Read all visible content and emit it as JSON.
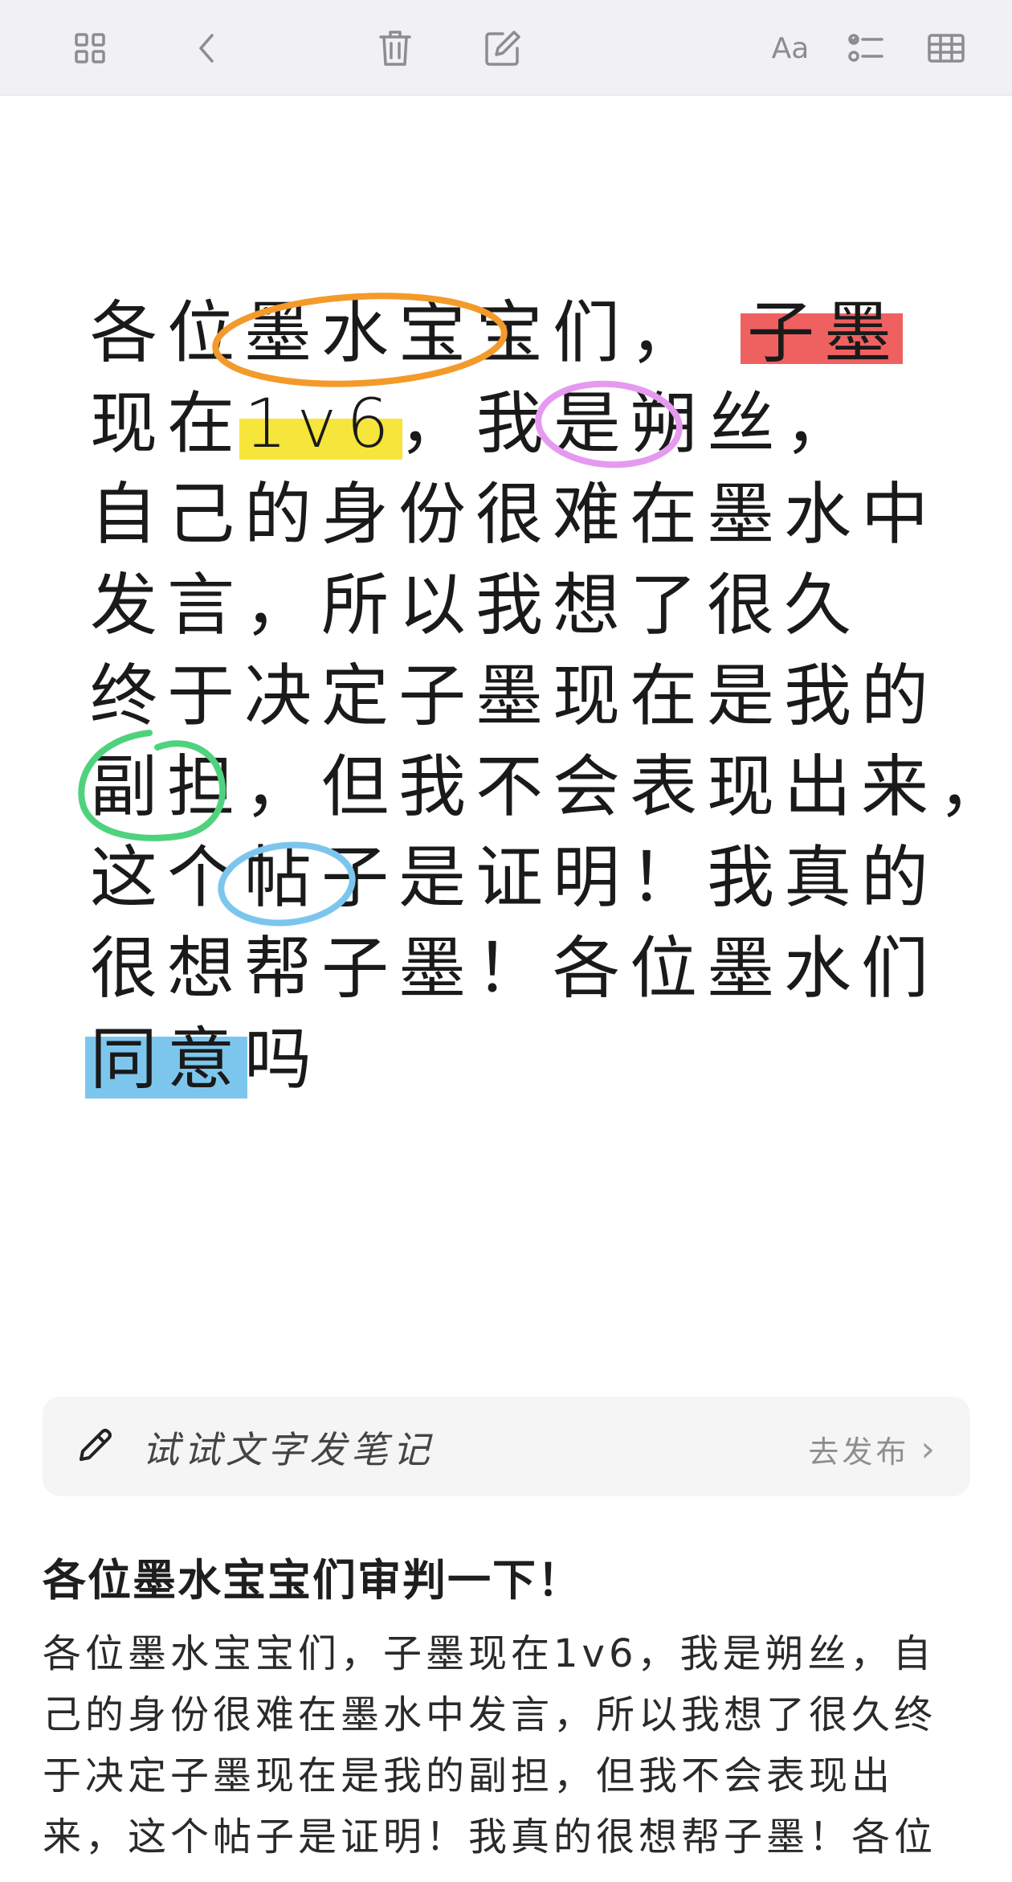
{
  "toolbar": {
    "icons": [
      "grid-icon",
      "back-icon",
      "trash-icon",
      "compose-icon",
      "text-format-icon",
      "checklist-icon",
      "table-icon"
    ],
    "text_format_label": "Aa"
  },
  "note": {
    "lines": [
      {
        "parts": [
          "各位",
          "墨水宝宝",
          "们，",
          "子墨"
        ]
      },
      {
        "parts": [
          "现在",
          "1v6",
          "，我是",
          "朔丝",
          "，"
        ]
      },
      {
        "text": "自己的身份很难在墨水中"
      },
      {
        "text": "发言，所以我想了很久"
      },
      {
        "text": "终于决定子墨现在是我的"
      },
      {
        "parts": [
          "副担",
          "，但我不会表现出来，"
        ]
      },
      {
        "parts": [
          "这个",
          "帖子",
          "是证明！我真的"
        ]
      },
      {
        "text": "很想帮子墨！各位墨水们"
      },
      {
        "parts": [
          "同意",
          "吗"
        ]
      }
    ],
    "highlight_colors": {
      "orange": "#f39a2b",
      "red": "#ef6060",
      "yellow": "#f6e53a",
      "pink": "#e59af0",
      "green": "#4fd27e",
      "blue": "#7cc6ee"
    }
  },
  "action_bar": {
    "prompt": "试试文字发笔记",
    "publish_label": "去发布",
    "chevron": "›"
  },
  "post": {
    "title": "各位墨水宝宝们审判一下！",
    "body": "各位墨水宝宝们，子墨现在1v6，我是朔丝，自己的身份很难在墨水中发言，所以我想了很久终于决定子墨现在是我的副担，但我不会表现出来，这个帖子是证明！我真的很想帮子墨！各位"
  }
}
